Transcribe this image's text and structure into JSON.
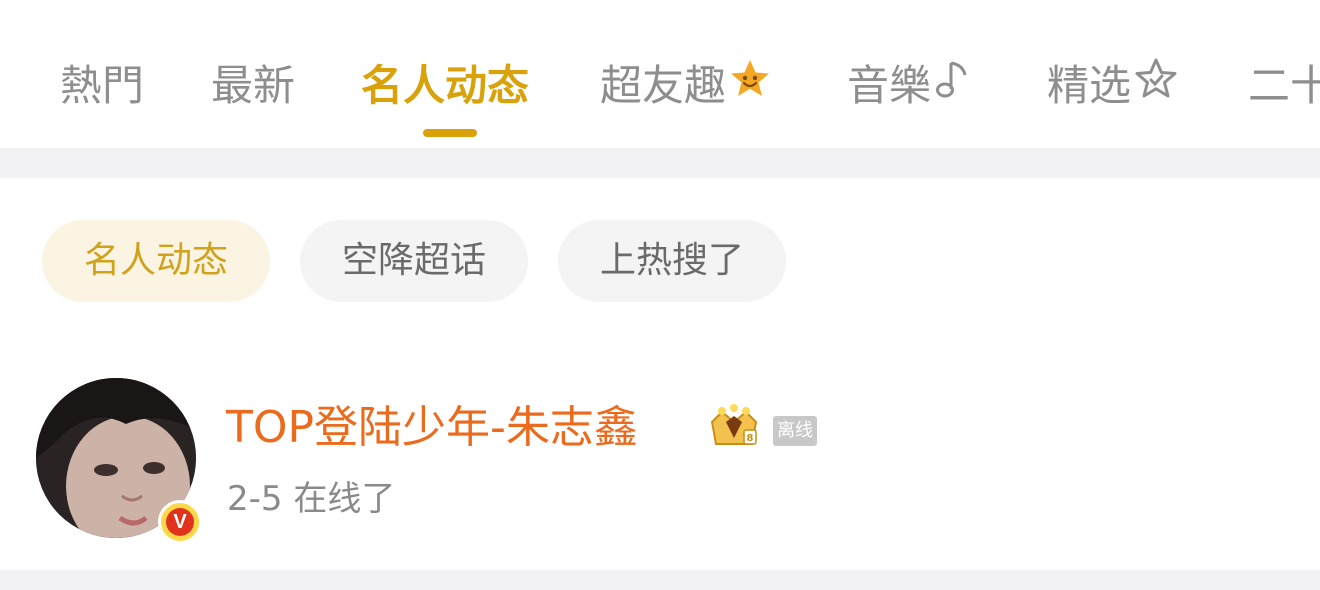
{
  "tabs": [
    {
      "label": "熱門",
      "active": false
    },
    {
      "label": "最新",
      "active": false
    },
    {
      "label": "名人动态",
      "active": true
    },
    {
      "label": "超友趣",
      "active": false,
      "icon": "star-face-icon"
    },
    {
      "label": "音樂",
      "active": false,
      "icon": "music-note-icon"
    },
    {
      "label": "精选",
      "active": false,
      "icon": "star-outline-icon"
    },
    {
      "label": "二十",
      "active": false
    }
  ],
  "chips": [
    {
      "label": "名人动态",
      "active": true
    },
    {
      "label": "空降超话",
      "active": false
    },
    {
      "label": "上热搜了",
      "active": false
    }
  ],
  "post": {
    "name": "TOP登陆少年-朱志鑫",
    "status_badge": "离线",
    "time_status": "2-5 在线了",
    "verified_mark": "V"
  },
  "colors": {
    "accent": "#d9a20a",
    "name_orange": "#ec6a1c",
    "verified_red": "#e0321c",
    "verified_yellow": "#ffd84a",
    "band_gray": "#f2f2f4"
  }
}
